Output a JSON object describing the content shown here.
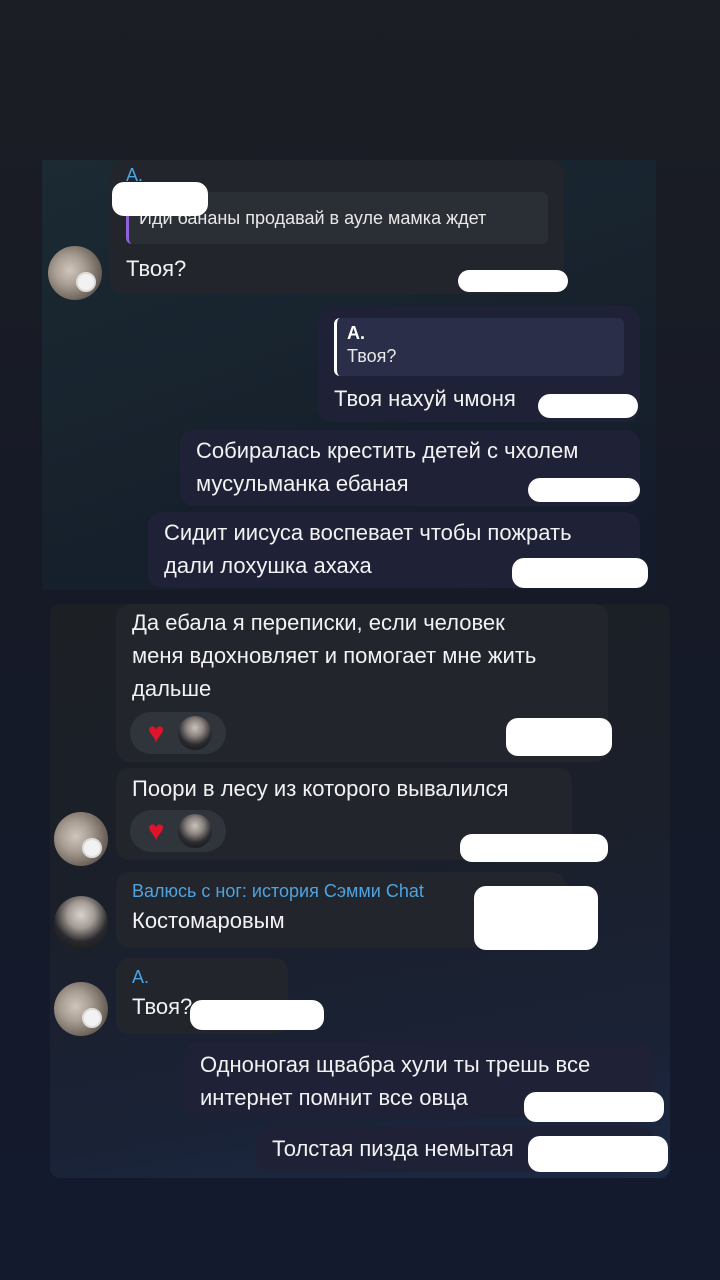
{
  "top_chat": {
    "m1": {
      "sender": "А.",
      "reply_text": "Иди бананы продавай в ауле мамка ждет",
      "text": "Твоя?"
    },
    "m2": {
      "reply_name": "А.",
      "reply_text": "Твоя?",
      "text": "Твоя нахуй чмоня"
    },
    "m3": {
      "text": "Собиралась крестить детей с чхолем\nмусульманка ебаная"
    },
    "m4": {
      "text": "Сидит иисуса воспевает чтобы пожрать\nдали лохушка ахаха"
    }
  },
  "bottom_chat": {
    "m1": {
      "text": "Да ебала я переписки, если человек\nменя вдохновляет и помогает мне жить\nдальше"
    },
    "m2": {
      "text": "Поори в лесу из которого вывалился"
    },
    "m3": {
      "sender": "Валюсь с ног: история Сэмми Chat",
      "text": "Костомаровым"
    },
    "m4": {
      "sender": "А.",
      "text": "Твоя?"
    },
    "m5": {
      "text": "Одноногая щвабра хули ты трешь все\nинтернет помнит все овца"
    },
    "m6": {
      "text": "Толстая пизда немытая"
    }
  },
  "colors": {
    "sender_name": "#4ea3e0",
    "incoming_bubble": "#22262c",
    "outgoing_bubble": "#1f2236",
    "reply_bar": "#8c63d9",
    "heart": "#e0132a"
  },
  "icons": [
    "heart-icon",
    "avatar-cat",
    "avatar-girl"
  ]
}
